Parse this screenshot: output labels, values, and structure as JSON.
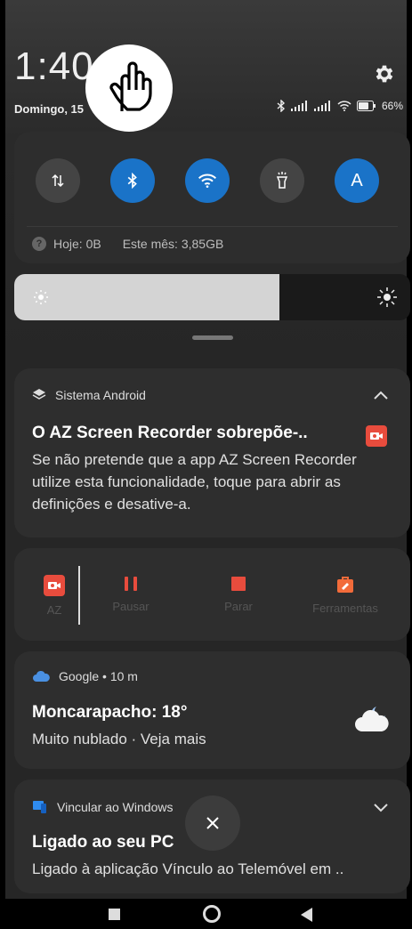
{
  "status": {
    "time": "1:40",
    "date": "Domingo, 15",
    "battery": "66%"
  },
  "quick_toggles": [
    {
      "name": "data-transfer",
      "state": "off",
      "icon": "arrows-updown-icon"
    },
    {
      "name": "bluetooth",
      "state": "on",
      "icon": "bluetooth-icon"
    },
    {
      "name": "wifi",
      "state": "on",
      "icon": "wifi-icon"
    },
    {
      "name": "flashlight",
      "state": "off",
      "icon": "flashlight-icon"
    },
    {
      "name": "auto-brightness",
      "state": "on",
      "label": "A"
    }
  ],
  "data_usage": {
    "today": "Hoje: 0B",
    "month": "Este mês: 3,85GB"
  },
  "brightness": {
    "level": 0.67
  },
  "notifications": {
    "android": {
      "app": "Sistema Android",
      "title": "O AZ Screen Recorder sobrepõe-..",
      "body": "Se não pretende que a app AZ Screen Recorder utilize esta funcionalidade, toque para abrir as definições e desative-a."
    },
    "recorder": {
      "app_label": "AZ",
      "pause": "Pausar",
      "stop": "Parar",
      "tools": "Ferramentas"
    },
    "weather": {
      "header": "Google • 10 m",
      "title": "Moncarapacho: 18°",
      "body": "Muito nublado · Veja mais"
    },
    "windows": {
      "app": "Vincular ao Windows",
      "title": "Ligado ao seu PC",
      "body": "Ligado à aplicação Vínculo ao Telemóvel em .."
    }
  },
  "colors": {
    "accent": "#1a73c8",
    "recorder_red": "#e84c3d",
    "card_bg": "#2e2e2e"
  }
}
